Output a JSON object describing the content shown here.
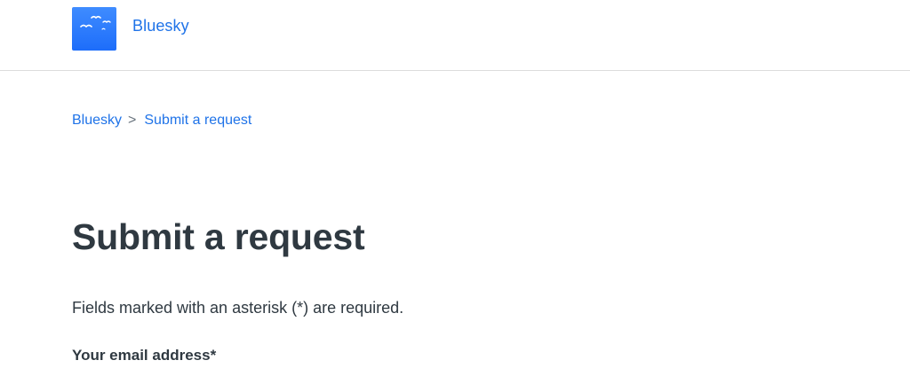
{
  "header": {
    "logo_alt": "Bluesky",
    "brand": "Bluesky",
    "accent": "#1f73e8",
    "logo_color": "#2a7aff"
  },
  "breadcrumb": {
    "items": [
      {
        "label": "Bluesky"
      },
      {
        "label": "Submit a request"
      }
    ],
    "separator": ">"
  },
  "main": {
    "title": "Submit a request",
    "required_note": "Fields marked with an asterisk (*) are required.",
    "fields": [
      {
        "label": "Your email address*"
      }
    ]
  }
}
